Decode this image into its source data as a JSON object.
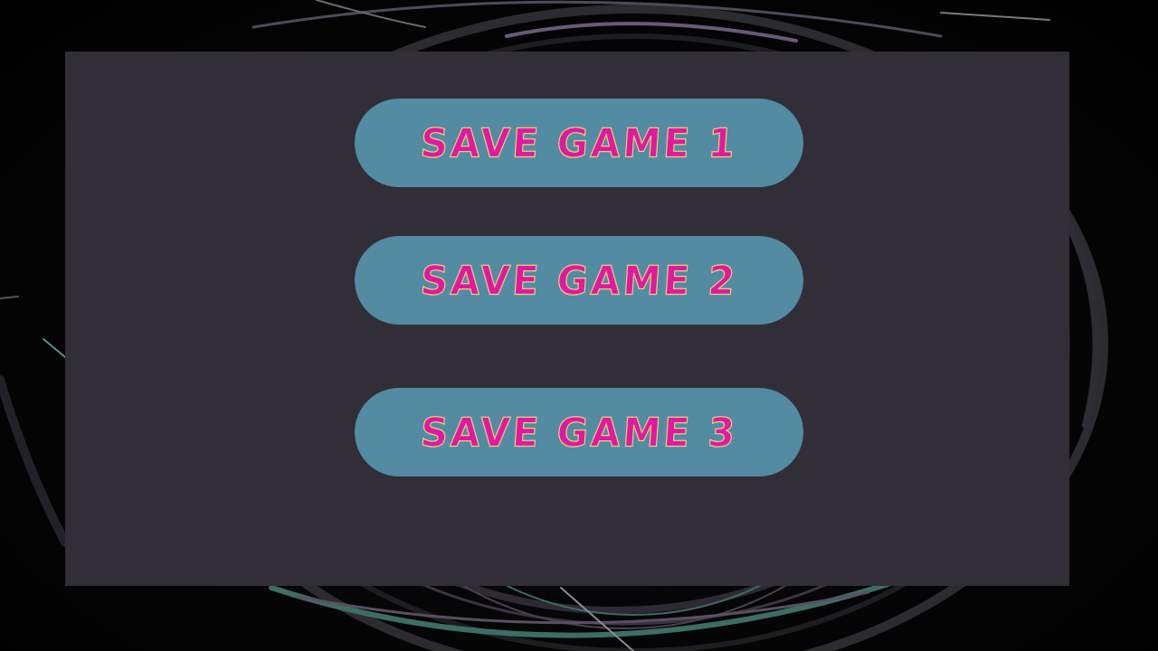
{
  "theme": {
    "background": "#000000",
    "panel": "#312e38",
    "button": "#528ba2",
    "label_fill": "#e0199f",
    "label_outline": "#e8d07a"
  },
  "save_menu": {
    "slots": [
      {
        "label": "SAVE GAME 1"
      },
      {
        "label": "SAVE GAME 2"
      },
      {
        "label": "SAVE GAME 3"
      }
    ]
  }
}
